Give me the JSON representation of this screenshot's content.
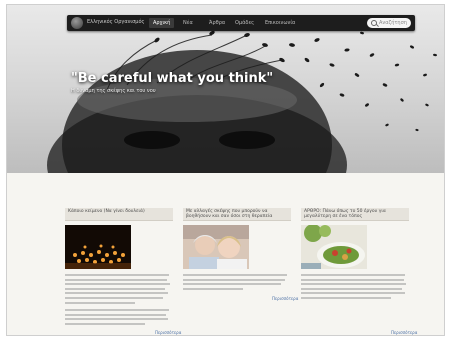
{
  "nav": {
    "brand": "Ελληνικός Οργανισμός",
    "items": [
      {
        "label": "Αρχική",
        "active": true
      },
      {
        "label": "Νέα",
        "active": false
      },
      {
        "label": "Άρθρα",
        "active": false
      },
      {
        "label": "Ομάδες",
        "active": false
      },
      {
        "label": "Επικοινωνία",
        "active": false
      }
    ],
    "search_placeholder": "Αναζήτηση"
  },
  "hero": {
    "quote": "\"Be careful what you think\"",
    "subtitle": "Η δύναμη της σκέψης και του νου"
  },
  "columns": [
    {
      "heading": "Κάποιο κείμενο (Να γίνει δουλειά)",
      "thumb_icon": "candles-image",
      "more": "Περισσότερα"
    },
    {
      "heading": "Με αλλαγές σκέψης που μπορούν να βοηθήσουν και σαν όσοι στη θεραπεία",
      "thumb_icon": "elderly-couple-image",
      "more": "Περισσότερα"
    },
    {
      "heading": "ΑΡΘΡΟ: Πάνω όπως το 50 έργου για μεγαλύτερη σε ένα τόπος",
      "thumb_icon": "salad-plate-image",
      "more": "Περισσότερα"
    }
  ],
  "colors": {
    "navbar": "#1d1d1d",
    "link": "#4a6fa5"
  }
}
